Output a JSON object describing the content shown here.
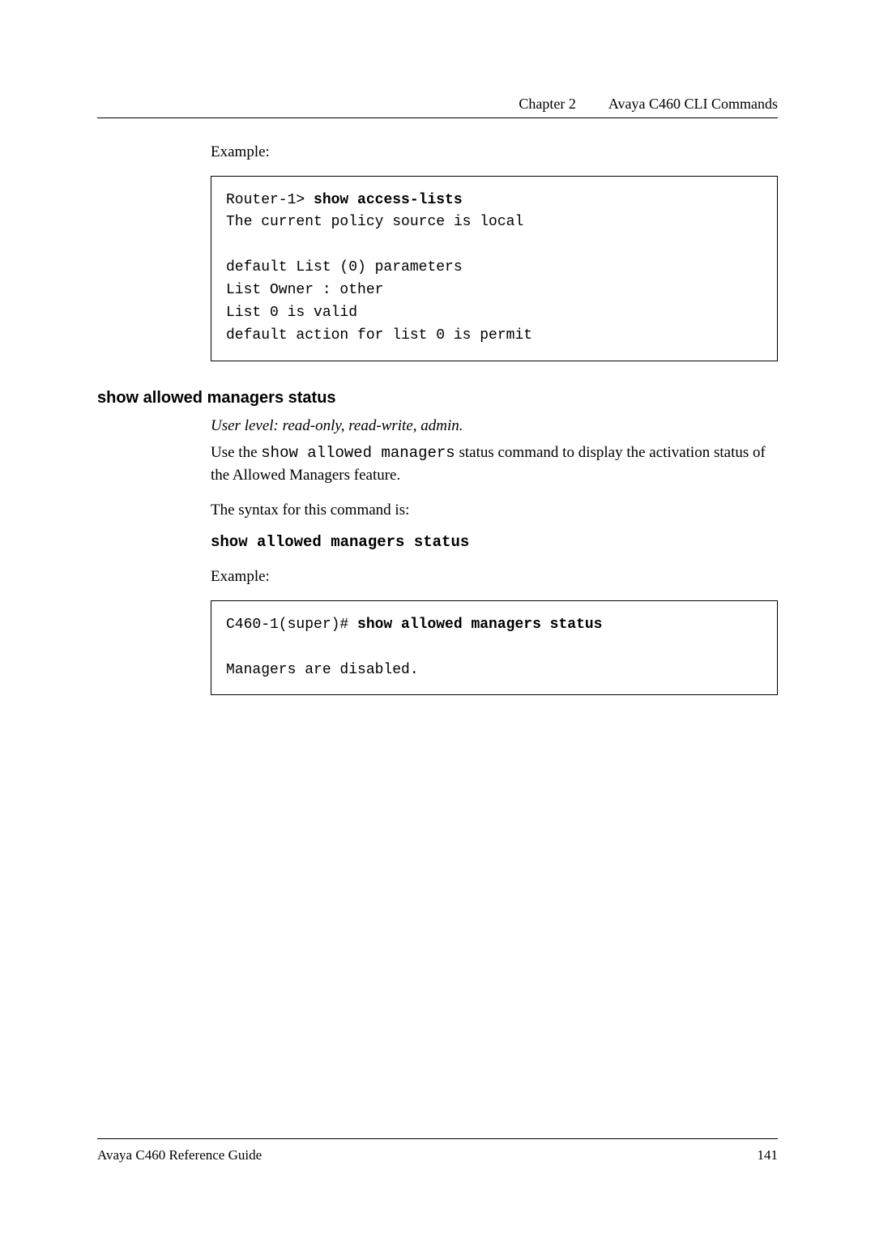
{
  "header": {
    "chapter": "Chapter 2",
    "title": "Avaya C460 CLI Commands"
  },
  "example1_label": "Example:",
  "codebox1": {
    "line1_prompt": "Router-1> ",
    "line1_cmd": "show access-lists",
    "line2": "The current policy source is local",
    "blank": "",
    "line3": "default List (0) parameters",
    "line4": "List Owner : other",
    "line5": "List 0 is valid",
    "line6": "default action for list 0 is permit"
  },
  "section_heading": "show allowed managers status",
  "userlevel": "User level: read-only, read-write, admin.",
  "para1_pre": "Use the ",
  "para1_mono": "show allowed managers",
  "para1_post": " status command to display the activation status of the Allowed Managers feature.",
  "syntax_label": "The syntax for this command is:",
  "syntax_cmd": "show allowed managers status",
  "example2_label": "Example:",
  "codebox2": {
    "line1_prompt": "C460-1(super)# ",
    "line1_cmd": "show allowed managers status",
    "blank": "",
    "line2": "Managers are disabled."
  },
  "footer": {
    "left": "Avaya C460 Reference Guide",
    "right": "141"
  }
}
